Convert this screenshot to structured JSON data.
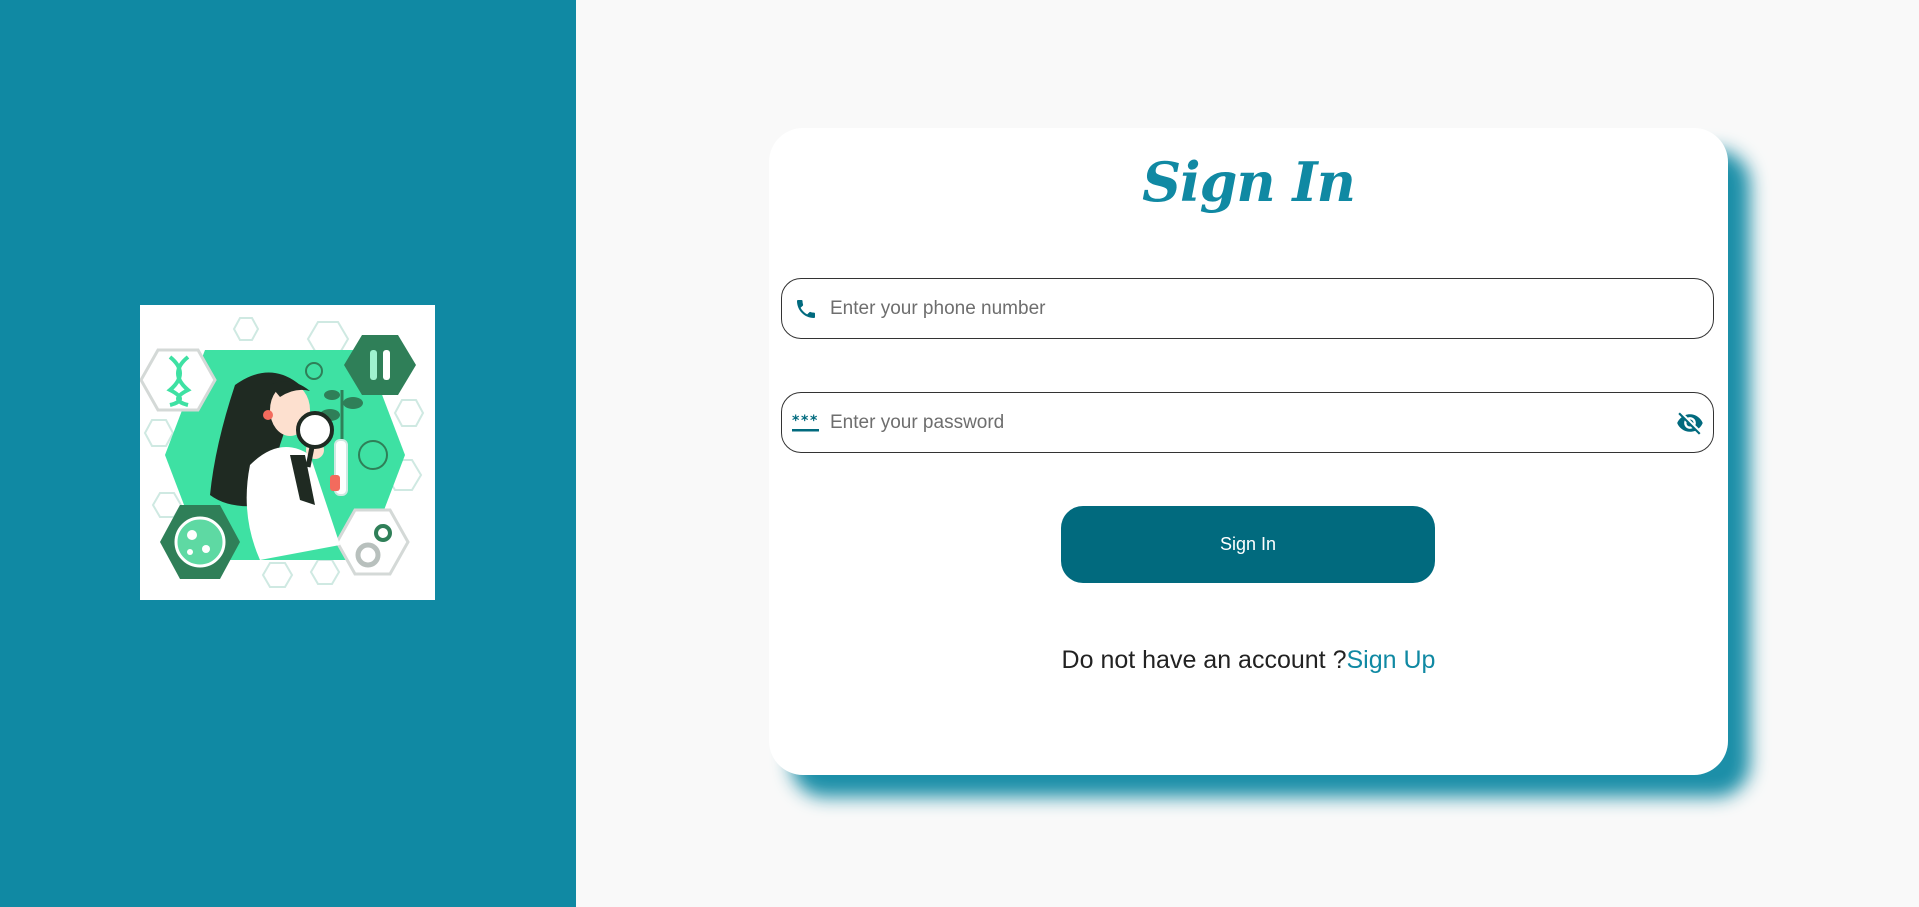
{
  "colors": {
    "accent": "#1089a3",
    "button": "#016a7e",
    "background": "#f9f9f9",
    "card": "#ffffff",
    "illustration_green": "#3ee1a3",
    "illustration_dark_green": "#2f7f58"
  },
  "illustration": {
    "icon": "scientist-with-magnifier-illustration"
  },
  "signin": {
    "title": "Sign In",
    "phone": {
      "icon": "phone-icon",
      "value": "",
      "placeholder": "Enter your phone number"
    },
    "password": {
      "icon": "password-asterisks-icon",
      "toggle_icon": "eye-off-icon",
      "value": "",
      "placeholder": "Enter your password"
    },
    "button_label": "Sign In",
    "no_account_text": "Do not have an account ?",
    "signup_link": "Sign Up"
  }
}
